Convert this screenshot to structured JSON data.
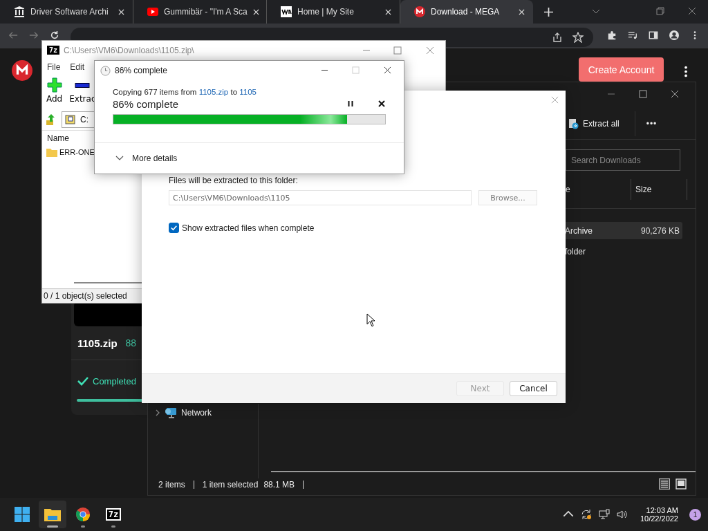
{
  "browser": {
    "tabs": [
      {
        "title": "Driver Software Archi",
        "selected": false
      },
      {
        "title": "Gummibär - \"I'm A Sca",
        "selected": false
      },
      {
        "title": "Home | My Site",
        "selected": false
      },
      {
        "title": "Download - MEGA",
        "selected": true
      }
    ]
  },
  "mega": {
    "create_account": "Create Account",
    "file_name": "1105.zip",
    "file_size": "88",
    "status": "Completed"
  },
  "explorer": {
    "extract_all": "Extract all",
    "more": "•••",
    "search": {
      "placeholder": "Search Downloads"
    },
    "columns": [
      "e",
      "Size"
    ],
    "rows": [
      {
        "name": "Archive",
        "size": "90,276 KB",
        "selected": true
      },
      {
        "name": "folder",
        "selected": false
      }
    ],
    "nav": [
      {
        "label": "Network"
      }
    ],
    "status": [
      "2 items",
      "1 item selected",
      "88.1 MB"
    ]
  },
  "sevenzip": {
    "logo": "7z",
    "title": "C:\\Users\\VM6\\Downloads\\1105.zip\\",
    "menu": [
      "File",
      "Edit"
    ],
    "toolbar": [
      {
        "label": "Add",
        "kind": "add"
      },
      {
        "label": "Extrac",
        "kind": "extract"
      }
    ],
    "path": "C:",
    "columns": [
      "Name"
    ],
    "rows": [
      "ERR-ONE"
    ],
    "status": "0 / 1 object(s) selected"
  },
  "extract_dialog": {
    "label": "Files will be extracted to this folder:",
    "path": "C:\\Users\\VM6\\Downloads\\1105",
    "browse": "Browse...",
    "show_files": {
      "label": "Show extracted files when complete",
      "checked": true
    },
    "buttons": [
      {
        "label": "Next",
        "disabled": true
      },
      {
        "label": "Cancel",
        "disabled": false
      }
    ]
  },
  "progress_dialog": {
    "title": "86% complete",
    "copying": "Copying 677 items from",
    "source": "1105.zip",
    "joiner": "to",
    "destination": "1105",
    "heading": "86% complete",
    "level": 0.86,
    "more_details": "More details"
  },
  "taskbar": {
    "apps": [
      {
        "kind": "start",
        "active": false
      },
      {
        "kind": "explorer",
        "active": true
      },
      {
        "kind": "chrome",
        "active": false
      },
      {
        "kind": "sevenzip",
        "label": "7z",
        "active": false
      }
    ],
    "time": "12:03 AM",
    "date": "10/22/2022",
    "notifications": "1"
  }
}
